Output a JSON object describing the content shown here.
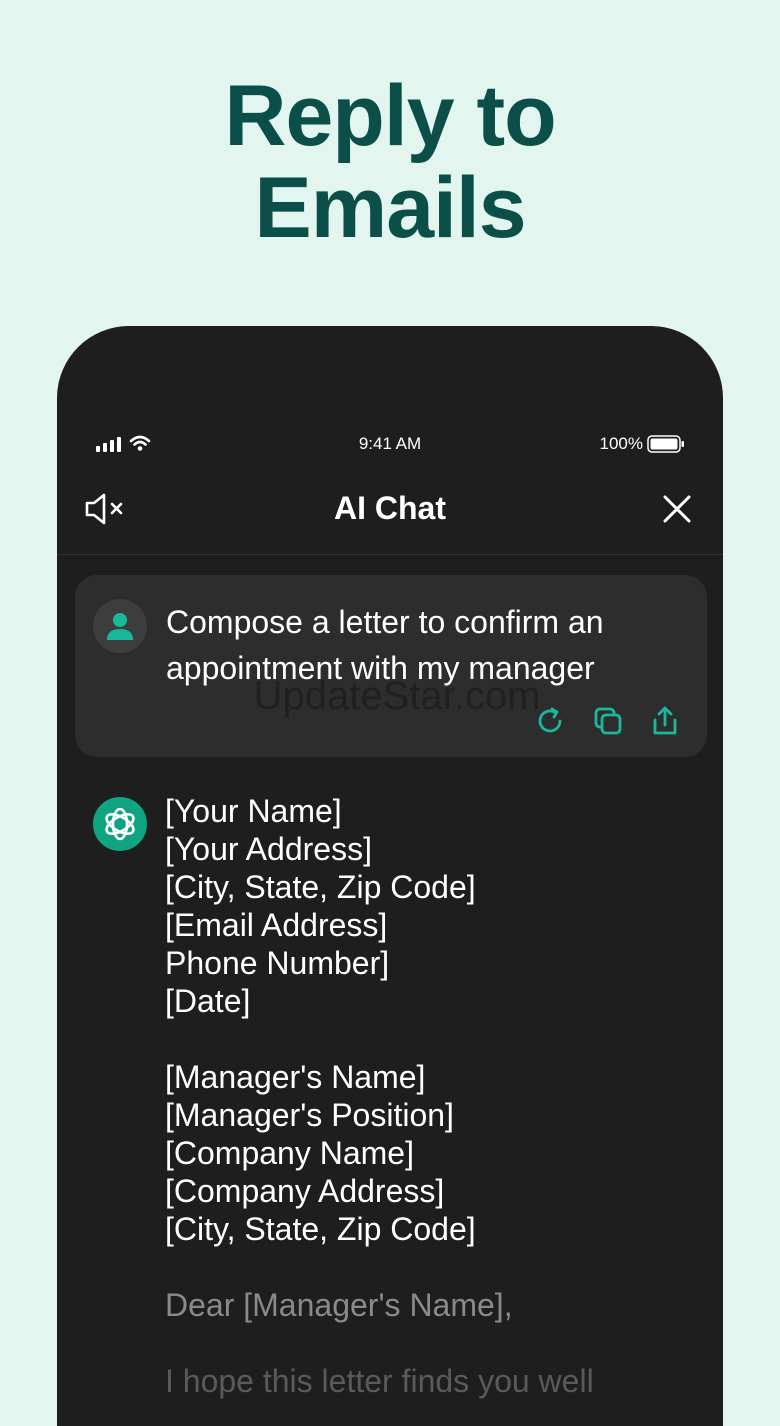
{
  "headline": {
    "line1": "Reply to",
    "line2": "Emails"
  },
  "status_bar": {
    "time": "9:41 AM",
    "battery": "100%"
  },
  "nav": {
    "title": "AI Chat"
  },
  "watermark": "UpdateStar.com",
  "user_message": {
    "text": "Compose a letter to confirm an appointment with my manager"
  },
  "assistant_message": {
    "lines": [
      "[Your Name]",
      "[Your Address]",
      "[City, State, Zip Code]",
      "[Email Address]",
      "Phone Number]",
      "[Date]",
      "",
      "[Manager's Name]",
      "[Manager's Position]",
      "[Company Name]",
      "[Company Address]",
      "[City, State, Zip Code]",
      "",
      "Dear [Manager's Name],",
      "",
      "I hope this letter finds you well"
    ]
  },
  "colors": {
    "background": "#e2f5ee",
    "headline": "#0b4f48",
    "accent": "#19b89a",
    "phone": "#1e1e1e",
    "card": "#2d2d2d"
  },
  "icons": [
    "signal-icon",
    "wifi-icon",
    "battery-icon",
    "speaker-mute-icon",
    "close-icon",
    "user-avatar-icon",
    "ai-logo-icon",
    "regenerate-icon",
    "copy-icon",
    "share-icon"
  ]
}
